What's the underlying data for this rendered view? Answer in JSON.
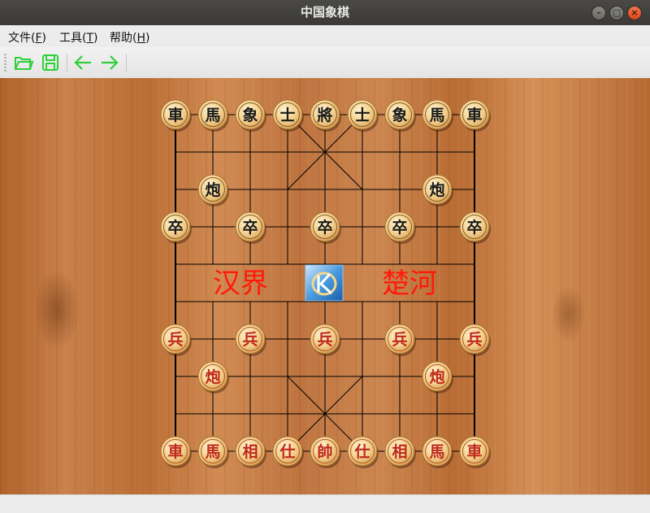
{
  "window": {
    "title": "中国象棋"
  },
  "menu": [
    {
      "label": "文件(",
      "key": "F",
      "tail": ")"
    },
    {
      "label": "工具(",
      "key": "T",
      "tail": ")"
    },
    {
      "label": "帮助(",
      "key": "H",
      "tail": ")"
    }
  ],
  "toolbar": {
    "buttons": [
      {
        "name": "open-folder-icon"
      },
      {
        "name": "save-icon"
      },
      {
        "name": "undo-arrow-icon"
      },
      {
        "name": "redo-arrow-icon"
      }
    ]
  },
  "board": {
    "river": {
      "left_text": "汉界",
      "right_text": "楚河"
    },
    "colors": {
      "black_piece_text": "#1a1a1a",
      "red_piece_text": "#c0281a",
      "line": "#000000",
      "icon_text": "#ffffff"
    },
    "pieces": [
      {
        "label": "車",
        "side": "black",
        "col": 0,
        "row": 0
      },
      {
        "label": "馬",
        "side": "black",
        "col": 1,
        "row": 0
      },
      {
        "label": "象",
        "side": "black",
        "col": 2,
        "row": 0
      },
      {
        "label": "士",
        "side": "black",
        "col": 3,
        "row": 0
      },
      {
        "label": "將",
        "side": "black",
        "col": 4,
        "row": 0
      },
      {
        "label": "士",
        "side": "black",
        "col": 5,
        "row": 0
      },
      {
        "label": "象",
        "side": "black",
        "col": 6,
        "row": 0
      },
      {
        "label": "馬",
        "side": "black",
        "col": 7,
        "row": 0
      },
      {
        "label": "車",
        "side": "black",
        "col": 8,
        "row": 0
      },
      {
        "label": "炮",
        "side": "black",
        "col": 1,
        "row": 2
      },
      {
        "label": "炮",
        "side": "black",
        "col": 7,
        "row": 2
      },
      {
        "label": "卒",
        "side": "black",
        "col": 0,
        "row": 3
      },
      {
        "label": "卒",
        "side": "black",
        "col": 2,
        "row": 3
      },
      {
        "label": "卒",
        "side": "black",
        "col": 4,
        "row": 3
      },
      {
        "label": "卒",
        "side": "black",
        "col": 6,
        "row": 3
      },
      {
        "label": "卒",
        "side": "black",
        "col": 8,
        "row": 3
      },
      {
        "label": "兵",
        "side": "red",
        "col": 0,
        "row": 6
      },
      {
        "label": "兵",
        "side": "red",
        "col": 2,
        "row": 6
      },
      {
        "label": "兵",
        "side": "red",
        "col": 4,
        "row": 6
      },
      {
        "label": "兵",
        "side": "red",
        "col": 6,
        "row": 6
      },
      {
        "label": "兵",
        "side": "red",
        "col": 8,
        "row": 6
      },
      {
        "label": "炮",
        "side": "red",
        "col": 1,
        "row": 7
      },
      {
        "label": "炮",
        "side": "red",
        "col": 7,
        "row": 7
      },
      {
        "label": "車",
        "side": "red",
        "col": 0,
        "row": 9
      },
      {
        "label": "馬",
        "side": "red",
        "col": 1,
        "row": 9
      },
      {
        "label": "相",
        "side": "red",
        "col": 2,
        "row": 9
      },
      {
        "label": "仕",
        "side": "red",
        "col": 3,
        "row": 9
      },
      {
        "label": "帥",
        "side": "red",
        "col": 4,
        "row": 9
      },
      {
        "label": "仕",
        "side": "red",
        "col": 5,
        "row": 9
      },
      {
        "label": "相",
        "side": "red",
        "col": 6,
        "row": 9
      },
      {
        "label": "馬",
        "side": "red",
        "col": 7,
        "row": 9
      },
      {
        "label": "車",
        "side": "red",
        "col": 8,
        "row": 9
      }
    ]
  }
}
